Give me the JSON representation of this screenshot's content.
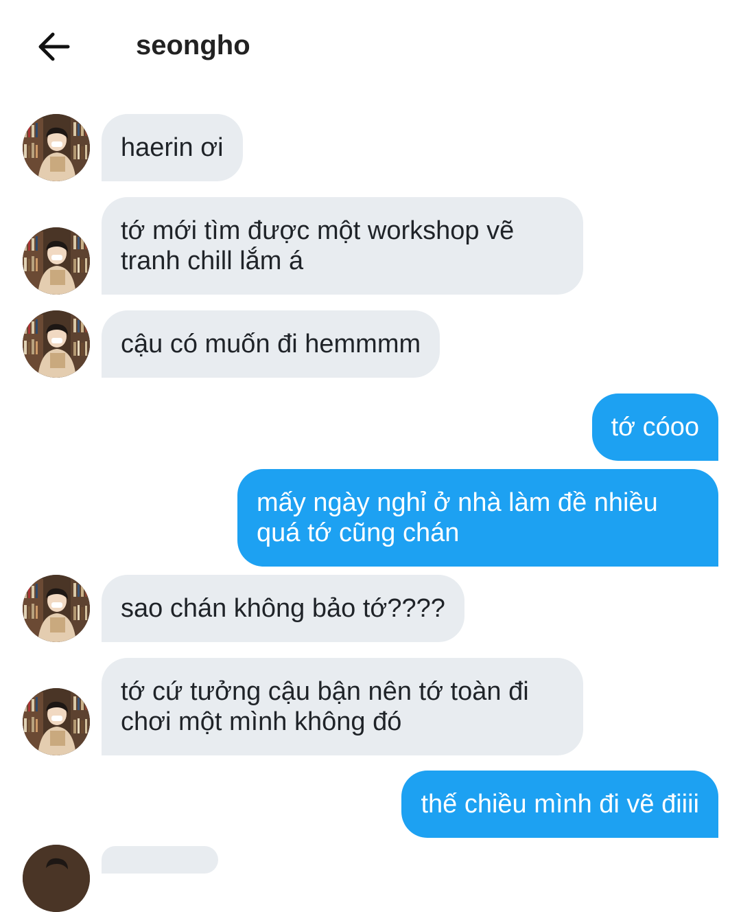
{
  "header": {
    "title": "seongho"
  },
  "messages": [
    {
      "text": "haerin ơi"
    },
    {
      "text": "tớ mới tìm được một workshop vẽ\ntranh chill lắm á"
    },
    {
      "text": "cậu có muốn đi hemmmm"
    },
    {
      "text": "tớ cóoo"
    },
    {
      "text": "mấy ngày nghỉ ở nhà làm đề nhiều\nquá tớ cũng chán"
    },
    {
      "text": "sao chán không bảo tớ????"
    },
    {
      "text": "tớ cứ tưởng cậu bận nên tớ toàn đi\nchơi một mình không đó"
    },
    {
      "text": "thế chiều mình đi vẽ điiii"
    }
  ],
  "colors": {
    "outgoing_bubble": "#1da1f2",
    "incoming_bubble": "#e8ecf0"
  },
  "icons": {
    "back": "arrow-left-icon"
  }
}
